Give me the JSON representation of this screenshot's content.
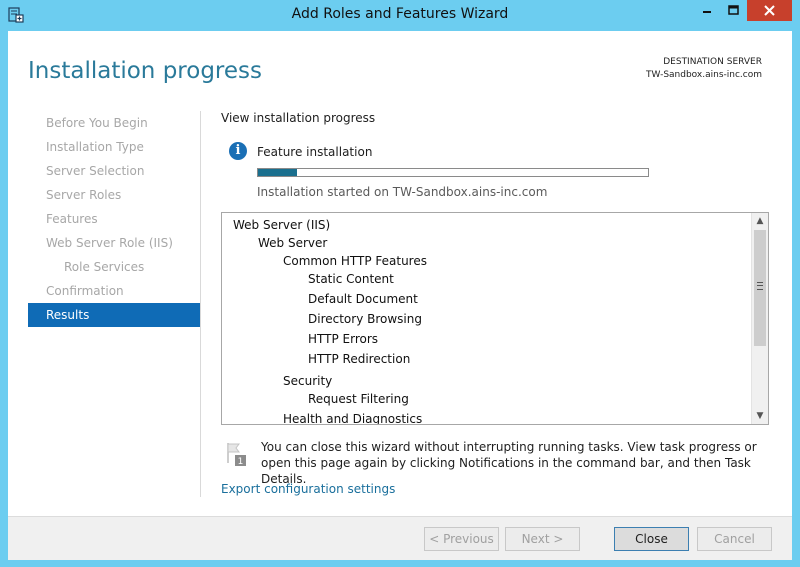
{
  "window": {
    "title": "Add Roles and Features Wizard",
    "icon": "server-manager-icon",
    "controls": [
      "minimize-icon",
      "maximize-icon",
      "close-icon"
    ]
  },
  "header": {
    "title": "Installation progress",
    "destination_label": "DESTINATION SERVER",
    "destination_value": "TW-Sandbox.ains-inc.com"
  },
  "nav": {
    "items": [
      {
        "label": "Before You Begin"
      },
      {
        "label": "Installation Type"
      },
      {
        "label": "Server Selection"
      },
      {
        "label": "Server Roles"
      },
      {
        "label": "Features"
      },
      {
        "label": "Web Server Role (IIS)"
      },
      {
        "label": "Role Services"
      },
      {
        "label": "Confirmation"
      },
      {
        "label": "Results"
      }
    ],
    "active": "Results"
  },
  "main": {
    "subtitle": "View installation progress",
    "feature_label": "Feature installation",
    "progress": 0.1,
    "started_text": "Installation started on TW-Sandbox.ains-inc.com",
    "tree": [
      {
        "label": "Web Server (IIS)",
        "level": 0
      },
      {
        "label": "Web Server",
        "level": 1
      },
      {
        "label": "Common HTTP Features",
        "level": 2
      },
      {
        "label": "Static Content",
        "level": 3
      },
      {
        "label": "Default Document",
        "level": 3
      },
      {
        "label": "Directory Browsing",
        "level": 3
      },
      {
        "label": "HTTP Errors",
        "level": 3
      },
      {
        "label": "HTTP Redirection",
        "level": 3
      },
      {
        "label": "Security",
        "level": 2
      },
      {
        "label": "Request Filtering",
        "level": 3
      },
      {
        "label": "Health and Diagnostics",
        "level": 2
      }
    ],
    "notice": "You can close this wizard without interrupting running tasks. View task progress or open this page again by clicking Notifications in the command bar, and then Task Details.",
    "export_link": "Export configuration settings"
  },
  "footer": {
    "previous": "< Previous",
    "next": "Next >",
    "close": "Close",
    "cancel": "Cancel"
  },
  "colors": {
    "frame": "#6ccdf0",
    "accent": "#0f6bb6",
    "header_title": "#2a7a9a",
    "progress_fill": "#1a6f8e",
    "link": "#1a6f9c",
    "close_button": "#c7402c"
  }
}
